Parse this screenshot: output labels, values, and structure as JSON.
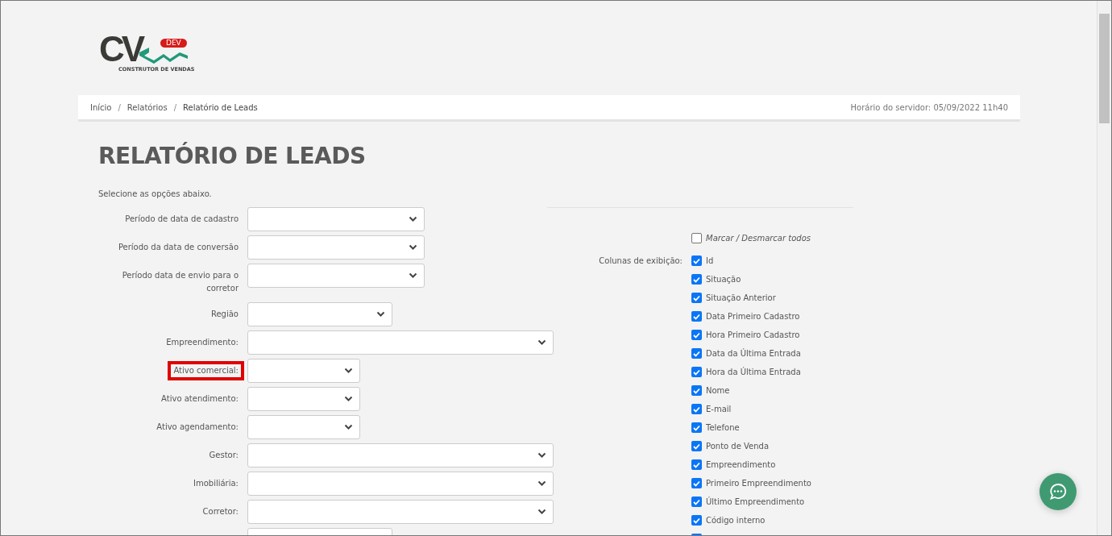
{
  "logo": {
    "mark": "CV",
    "badge": "DEV",
    "tagline": "CONSTRUTOR DE VENDAS"
  },
  "breadcrumb": {
    "items": [
      {
        "label": "Início",
        "current": false
      },
      {
        "label": "Relatórios",
        "current": false
      },
      {
        "label": "Relatório de Leads",
        "current": true
      }
    ],
    "separator": "/",
    "server_time": "Horário do servidor: 05/09/2022 11h40"
  },
  "title": "RELATÓRIO DE LEADS",
  "intro": "Selecione as opções abaixo.",
  "form": {
    "fields": [
      {
        "label": "Período de data de cadastro",
        "kind": "large",
        "highlighted": false
      },
      {
        "label": "Período da data de conversão",
        "kind": "large",
        "highlighted": false
      },
      {
        "label": "Período data de envio para o corretor",
        "kind": "large",
        "highlighted": false
      },
      {
        "label": "Região",
        "kind": "medium",
        "highlighted": false
      },
      {
        "label": "Empreendimento:",
        "kind": "wide",
        "highlighted": false
      },
      {
        "label": "Ativo comercial:",
        "kind": "small",
        "highlighted": true
      },
      {
        "label": "Ativo atendimento:",
        "kind": "small",
        "highlighted": false
      },
      {
        "label": "Ativo agendamento:",
        "kind": "small",
        "highlighted": false
      },
      {
        "label": "Gestor:",
        "kind": "wide",
        "highlighted": false
      },
      {
        "label": "Imobiliária:",
        "kind": "wide",
        "highlighted": false
      },
      {
        "label": "Corretor:",
        "kind": "wide",
        "highlighted": false
      },
      {
        "kind": "medium"
      }
    ]
  },
  "columns": {
    "toggle_all": {
      "label": "Marcar / Desmarcar todos",
      "checked": false
    },
    "label": "Colunas de exibição:",
    "items": [
      {
        "label": "Id",
        "checked": true
      },
      {
        "label": "Situação",
        "checked": true
      },
      {
        "label": "Situação Anterior",
        "checked": true
      },
      {
        "label": "Data Primeiro Cadastro",
        "checked": true
      },
      {
        "label": "Hora Primeiro Cadastro",
        "checked": true
      },
      {
        "label": "Data da Última Entrada",
        "checked": true
      },
      {
        "label": "Hora da Última Entrada",
        "checked": true
      },
      {
        "label": "Nome",
        "checked": true
      },
      {
        "label": "E-mail",
        "checked": true
      },
      {
        "label": "Telefone",
        "checked": true
      },
      {
        "label": "Ponto de Venda",
        "checked": true
      },
      {
        "label": "Empreendimento",
        "checked": true
      },
      {
        "label": "Primeiro Empreendimento",
        "checked": true
      },
      {
        "label": "Último Empreendimento",
        "checked": true
      },
      {
        "label": "Código interno",
        "checked": true
      },
      {
        "checked": true
      }
    ]
  }
}
